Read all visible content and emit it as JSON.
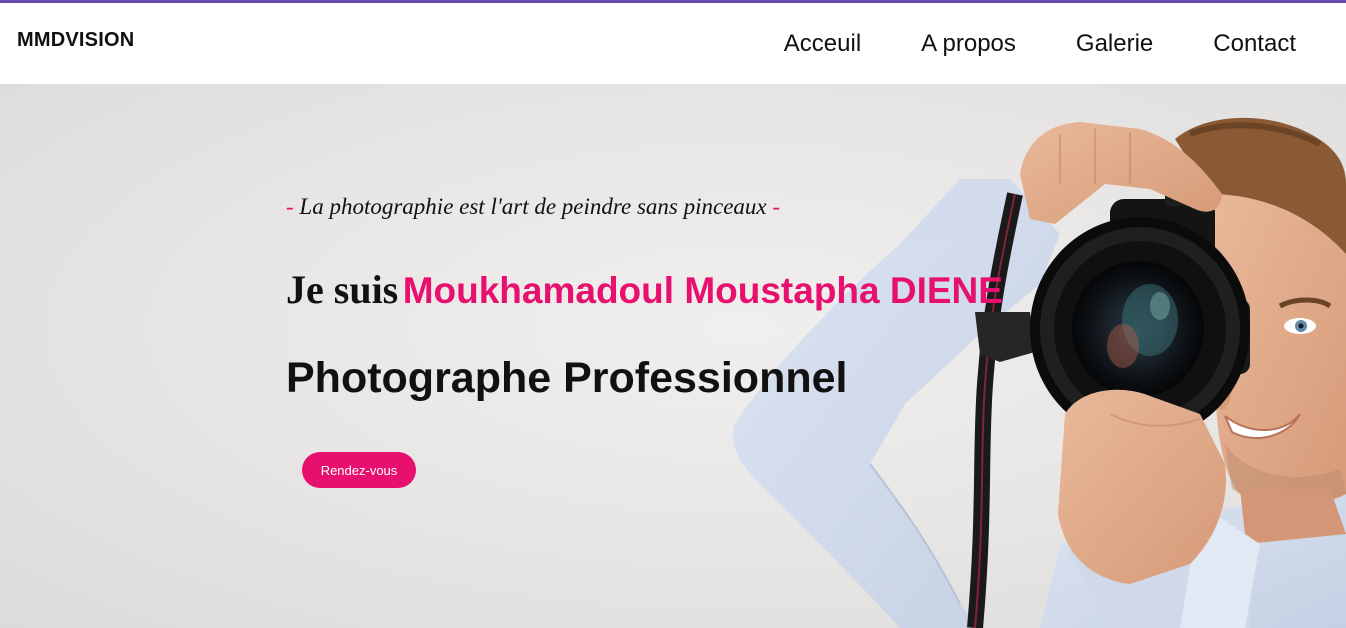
{
  "colors": {
    "top_accent": "#6a4bb0",
    "accent_pink": "#e8106e",
    "text_dark": "#111111",
    "hero_background": "#e9e7e6"
  },
  "navbar": {
    "logo": "MMDVISION",
    "links": [
      {
        "label": "Acceuil"
      },
      {
        "label": "A propos"
      },
      {
        "label": "Galerie"
      },
      {
        "label": "Contact"
      }
    ]
  },
  "hero": {
    "tagline_dash": "-",
    "tagline": "La photographie est l'art de peindre sans pinceaux",
    "intro_prefix": "Je suis",
    "name": "Moukhamadoul Moustapha DIENE",
    "profession": "Photographe Professionnel",
    "cta_label": "Rendez-vous",
    "image_subject": "photographer-with-camera"
  }
}
